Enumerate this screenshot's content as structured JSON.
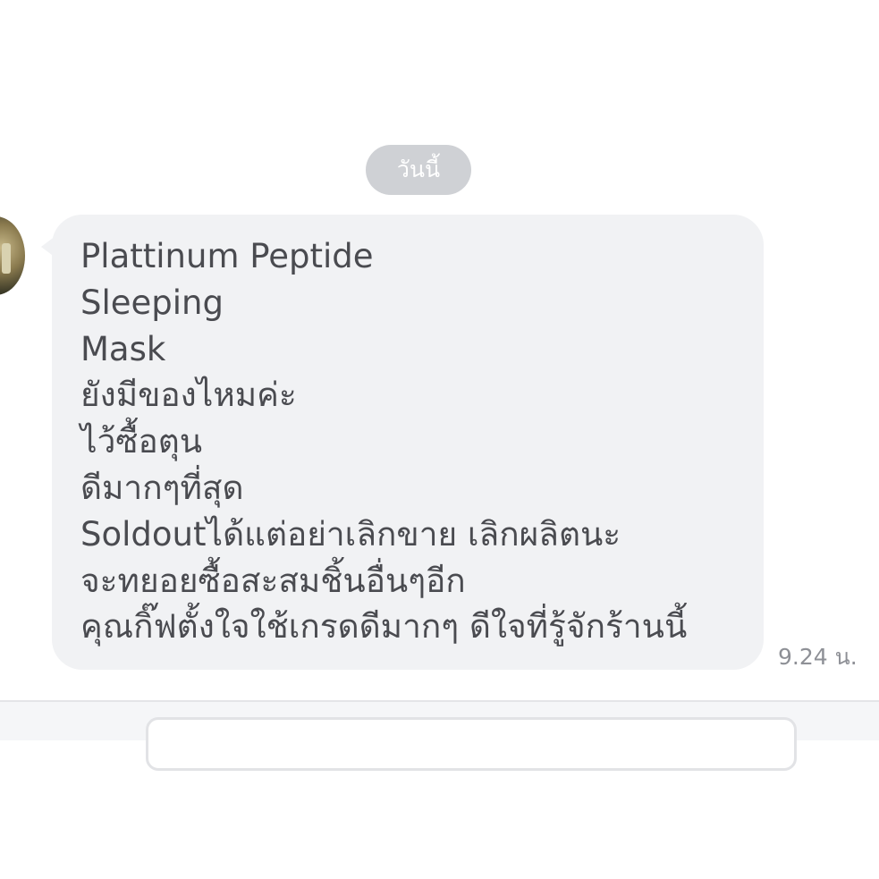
{
  "date_separator": "วันนี้",
  "message": {
    "lines": [
      "Plattinum Peptide",
      "Sleeping",
      "Mask",
      "ยังมีของไหมค่ะ",
      "ไว้ซื้อตุน",
      "ดีมากๆที่สุด",
      "Soldoutได้แต่อย่าเลิกขาย เลิกผลิตนะ",
      "จะทยอยซื้อสะสมชิ้นอื่นๆอีก",
      "คุณกิ๊ฟตั้งใจใช้เกรดดีมากๆ ดีใจที่รู้จักร้านนี้"
    ],
    "time": "9.24 น."
  },
  "colors": {
    "bubble_bg": "#f1f2f4",
    "text": "#4a4b50",
    "date_pill_bg": "#cfd1d5",
    "timestamp": "#8e9096"
  }
}
